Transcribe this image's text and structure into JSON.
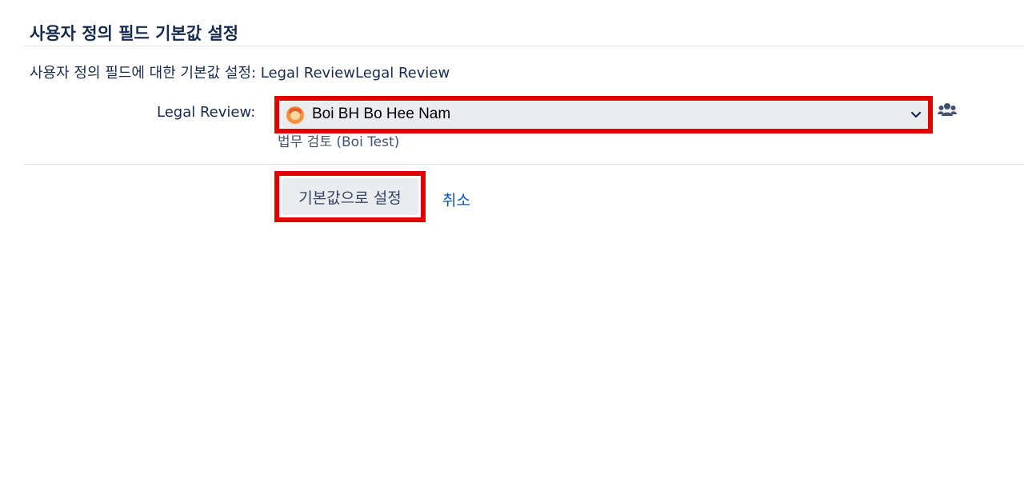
{
  "page": {
    "title": "사용자 정의 필드 기본값 설정",
    "description": "사용자 정의 필드에 대한 기본값 설정: Legal ReviewLegal Review"
  },
  "form": {
    "field_label": "Legal Review:",
    "selected_user": "Boi BH Bo Hee Nam",
    "field_description": "법무 검토 (Boi Test)",
    "submit_label": "기본값으로 설정",
    "cancel_label": "취소"
  },
  "icons": {
    "avatar": "user-avatar-icon",
    "dropdown": "chevron-down-icon",
    "group_picker": "user-group-icon"
  },
  "colors": {
    "highlight": "#e30000",
    "link": "#0052cc",
    "text": "#172b4d",
    "select_bg": "#ebecf0"
  }
}
